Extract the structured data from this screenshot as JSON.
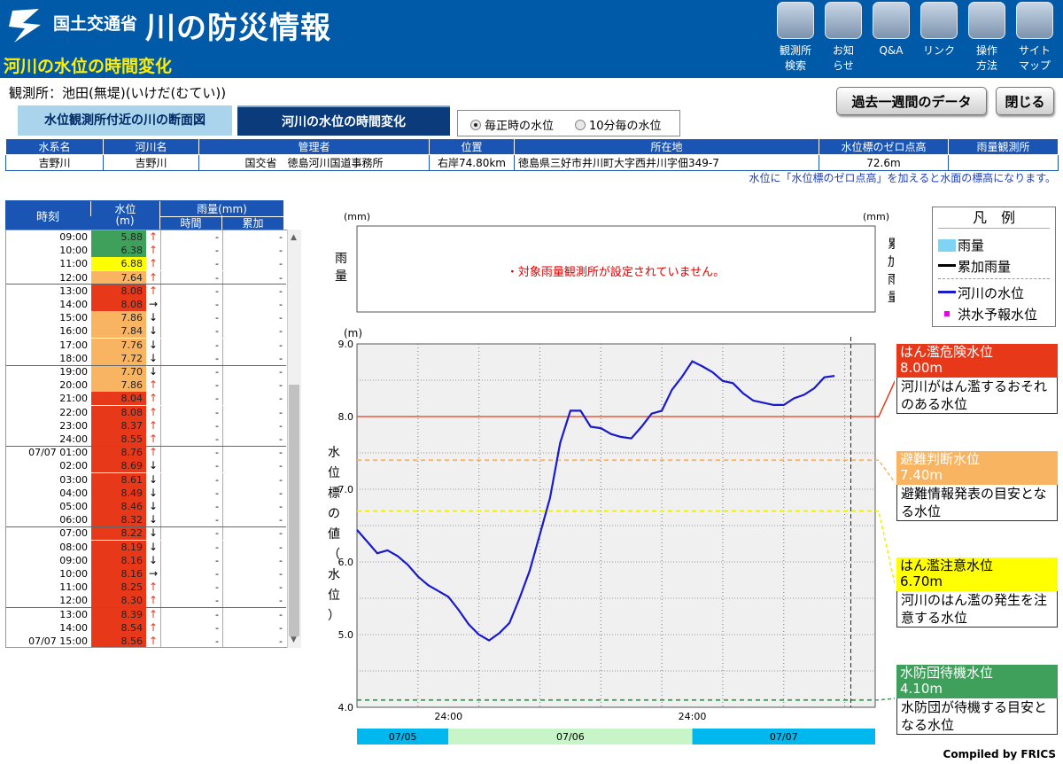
{
  "header": {
    "ministry": "国土交通省",
    "site_title": "川の防災情報",
    "page_heading": "河川の水位の時間変化",
    "nav": [
      {
        "label": "観測所\n検索",
        "icon": "search-icon"
      },
      {
        "label": "お知\nらせ",
        "icon": "info-icon"
      },
      {
        "label": "Q&A",
        "icon": "question-icon"
      },
      {
        "label": "リンク",
        "icon": "link-icon"
      },
      {
        "label": "操作\n方法",
        "icon": "mouse-icon"
      },
      {
        "label": "サイト\nマップ",
        "icon": "sitemap-icon"
      }
    ]
  },
  "station": {
    "label": "観測所：池田(無堤)(いけだ(むてい))"
  },
  "buttons": {
    "week": "過去一週間のデータ",
    "close": "閉じる"
  },
  "tabs": {
    "cross_section": "水位観測所付近の川の断面図",
    "level_change": "河川の水位の時間変化"
  },
  "radio": {
    "hourly": "毎正時の水位",
    "ten_min": "10分毎の水位"
  },
  "info": {
    "headers": [
      "水系名",
      "河川名",
      "管理者",
      "位置",
      "所在地",
      "水位標のゼロ点高",
      "雨量観測所"
    ],
    "values": [
      "吉野川",
      "吉野川",
      "国交省　徳島河川国道事務所",
      "右岸74.80km",
      "徳島県三好市井川町大字西井川字佃349-7",
      "72.6m",
      ""
    ]
  },
  "note": "水位に「水位標のゼロ点高」を加えると水面の標高になります。",
  "data_table": {
    "head_time": "時刻",
    "head_level": "水位",
    "head_level_unit": "(m)",
    "head_rain": "雨量(mm)",
    "head_rain_hour": "時間",
    "head_rain_total": "累加",
    "rows": [
      {
        "t": "09:00",
        "v": "5.88",
        "a": "↑",
        "c": "#3ea05a",
        "r1": "-",
        "r2": "-"
      },
      {
        "t": "10:00",
        "v": "6.38",
        "a": "↑",
        "c": "#3ea05a",
        "r1": "-",
        "r2": "-"
      },
      {
        "t": "11:00",
        "v": "6.88",
        "a": "↑",
        "c": "#ffff00",
        "r1": "-",
        "r2": "-"
      },
      {
        "t": "12:00",
        "v": "7.64",
        "a": "↑",
        "c": "#f9b462",
        "r1": "-",
        "r2": "-"
      },
      {
        "t": "13:00",
        "v": "8.08",
        "a": "↑",
        "c": "#e8381a",
        "r1": "-",
        "r2": "-"
      },
      {
        "t": "14:00",
        "v": "8.08",
        "a": "→",
        "c": "#e8381a",
        "r1": "-",
        "r2": "-"
      },
      {
        "t": "15:00",
        "v": "7.86",
        "a": "↓",
        "c": "#f9b462",
        "r1": "-",
        "r2": "-"
      },
      {
        "t": "16:00",
        "v": "7.84",
        "a": "↓",
        "c": "#f9b462",
        "r1": "-",
        "r2": "-"
      },
      {
        "t": "17:00",
        "v": "7.76",
        "a": "↓",
        "c": "#f9b462",
        "r1": "-",
        "r2": "-"
      },
      {
        "t": "18:00",
        "v": "7.72",
        "a": "↓",
        "c": "#f9b462",
        "r1": "-",
        "r2": "-"
      },
      {
        "t": "19:00",
        "v": "7.70",
        "a": "↓",
        "c": "#f9b462",
        "r1": "-",
        "r2": "-"
      },
      {
        "t": "20:00",
        "v": "7.86",
        "a": "↑",
        "c": "#f9b462",
        "r1": "-",
        "r2": "-"
      },
      {
        "t": "21:00",
        "v": "8.04",
        "a": "↑",
        "c": "#e8381a",
        "r1": "-",
        "r2": "-"
      },
      {
        "t": "22:00",
        "v": "8.08",
        "a": "↑",
        "c": "#e8381a",
        "r1": "-",
        "r2": "-"
      },
      {
        "t": "23:00",
        "v": "8.37",
        "a": "↑",
        "c": "#e8381a",
        "r1": "-",
        "r2": "-"
      },
      {
        "t": "24:00",
        "v": "8.55",
        "a": "↑",
        "c": "#e8381a",
        "r1": "-",
        "r2": "-"
      },
      {
        "t": "07/07 01:00",
        "v": "8.76",
        "a": "↑",
        "c": "#e8381a",
        "r1": "-",
        "r2": "-"
      },
      {
        "t": "02:00",
        "v": "8.69",
        "a": "↓",
        "c": "#e8381a",
        "r1": "-",
        "r2": "-"
      },
      {
        "t": "03:00",
        "v": "8.61",
        "a": "↓",
        "c": "#e8381a",
        "r1": "-",
        "r2": "-"
      },
      {
        "t": "04:00",
        "v": "8.49",
        "a": "↓",
        "c": "#e8381a",
        "r1": "-",
        "r2": "-"
      },
      {
        "t": "05:00",
        "v": "8.46",
        "a": "↓",
        "c": "#e8381a",
        "r1": "-",
        "r2": "-"
      },
      {
        "t": "06:00",
        "v": "8.32",
        "a": "↓",
        "c": "#e8381a",
        "r1": "-",
        "r2": "-"
      },
      {
        "t": "07:00",
        "v": "8.22",
        "a": "↓",
        "c": "#e8381a",
        "r1": "-",
        "r2": "-"
      },
      {
        "t": "08:00",
        "v": "8.19",
        "a": "↓",
        "c": "#e8381a",
        "r1": "-",
        "r2": "-"
      },
      {
        "t": "09:00",
        "v": "8.16",
        "a": "↓",
        "c": "#e8381a",
        "r1": "-",
        "r2": "-"
      },
      {
        "t": "10:00",
        "v": "8.16",
        "a": "→",
        "c": "#e8381a",
        "r1": "-",
        "r2": "-"
      },
      {
        "t": "11:00",
        "v": "8.25",
        "a": "↑",
        "c": "#e8381a",
        "r1": "-",
        "r2": "-"
      },
      {
        "t": "12:00",
        "v": "8.30",
        "a": "↑",
        "c": "#e8381a",
        "r1": "-",
        "r2": "-"
      },
      {
        "t": "13:00",
        "v": "8.39",
        "a": "↑",
        "c": "#e8381a",
        "r1": "-",
        "r2": "-"
      },
      {
        "t": "14:00",
        "v": "8.54",
        "a": "↑",
        "c": "#e8381a",
        "r1": "-",
        "r2": "-"
      },
      {
        "t": "07/07 15:00",
        "v": "8.56",
        "a": "↑",
        "c": "#e8381a",
        "r1": "-",
        "r2": "-"
      }
    ]
  },
  "rain_chart": {
    "unit_left": "(mm)",
    "unit_right": "(mm)",
    "ylabel_left": "雨量",
    "ylabel_right": "累加雨量",
    "message": "・対象雨量観測所が設定されていません。"
  },
  "legend": {
    "title": "凡　例",
    "items": [
      {
        "label": "雨量",
        "color": "#7fd4f4",
        "kind": "box"
      },
      {
        "label": "累加雨量",
        "color": "#000000",
        "kind": "line"
      },
      {
        "label": "河川の水位",
        "color": "#1a1acc",
        "kind": "line"
      },
      {
        "label": "洪水予報水位",
        "color": "#ee00ee",
        "kind": "dot"
      }
    ]
  },
  "thresholds": [
    {
      "name": "はん濫危険水位",
      "value_label": "8.00m",
      "desc": "河川がはん濫するおそれのある水位",
      "color": "#e8381a",
      "text_color": "#ffffff"
    },
    {
      "name": "避難判断水位",
      "value_label": "7.40m",
      "desc": "避難情報発表の目安となる水位",
      "color": "#f9b462",
      "text_color": "#ffffff"
    },
    {
      "name": "はん濫注意水位",
      "value_label": "6.70m",
      "desc": "河川のはん濫の発生を注意する水位",
      "color": "#ffff00",
      "text_color": "#000000"
    },
    {
      "name": "水防団待機水位",
      "value_label": "4.10m",
      "desc": "水防団が待機する目安となる水位",
      "color": "#3ea05a",
      "text_color": "#ffffff"
    }
  ],
  "date_bands": [
    {
      "label": "07/05",
      "color": "#00b8ee"
    },
    {
      "label": "07/06",
      "color": "#c8f5c8"
    },
    {
      "label": "07/07",
      "color": "#00b8ee"
    }
  ],
  "chart_data": {
    "type": "line",
    "title": "",
    "xlabel": "",
    "ylabel": "水位標の値（水位）",
    "yunit": "(m)",
    "ylim": [
      4.0,
      9.0
    ],
    "yticks": [
      "4.0",
      "5.0",
      "6.0",
      "7.0",
      "8.0",
      "9.0"
    ],
    "xticks": [
      "24:00",
      "24:00"
    ],
    "grid": true,
    "x_hours": [
      0,
      1,
      2,
      3,
      4,
      5,
      6,
      7,
      8,
      9,
      10,
      11,
      12,
      13,
      14,
      15,
      16,
      17,
      18,
      19,
      20,
      21,
      22,
      23,
      24,
      25,
      26,
      27,
      28,
      29,
      30,
      31,
      32,
      33,
      34,
      35,
      36,
      37,
      38,
      39,
      40,
      41,
      42,
      43,
      44,
      45,
      46,
      47,
      48,
      49,
      50,
      51
    ],
    "series": [
      {
        "name": "河川の水位",
        "color": "#1a1acc",
        "values": [
          6.44,
          6.28,
          6.12,
          6.16,
          6.08,
          5.96,
          5.8,
          5.68,
          5.6,
          5.52,
          5.34,
          5.14,
          5.0,
          4.92,
          5.02,
          5.16,
          5.5,
          5.88,
          6.38,
          6.88,
          7.64,
          8.08,
          8.08,
          7.86,
          7.84,
          7.76,
          7.72,
          7.7,
          7.86,
          8.04,
          8.08,
          8.37,
          8.55,
          8.76,
          8.69,
          8.61,
          8.49,
          8.46,
          8.32,
          8.22,
          8.19,
          8.16,
          8.16,
          8.25,
          8.3,
          8.39,
          8.54,
          8.56
        ]
      }
    ],
    "threshold_lines": [
      {
        "value": 8.0,
        "color": "#e8381a",
        "style": "solid"
      },
      {
        "value": 7.4,
        "color": "#f9b462",
        "style": "dashed"
      },
      {
        "value": 6.7,
        "color": "#eeee00",
        "style": "dashed"
      },
      {
        "value": 4.1,
        "color": "#3ea05a",
        "style": "dashed"
      }
    ]
  },
  "footer": {
    "compiled": "Compiled by FRICS"
  }
}
